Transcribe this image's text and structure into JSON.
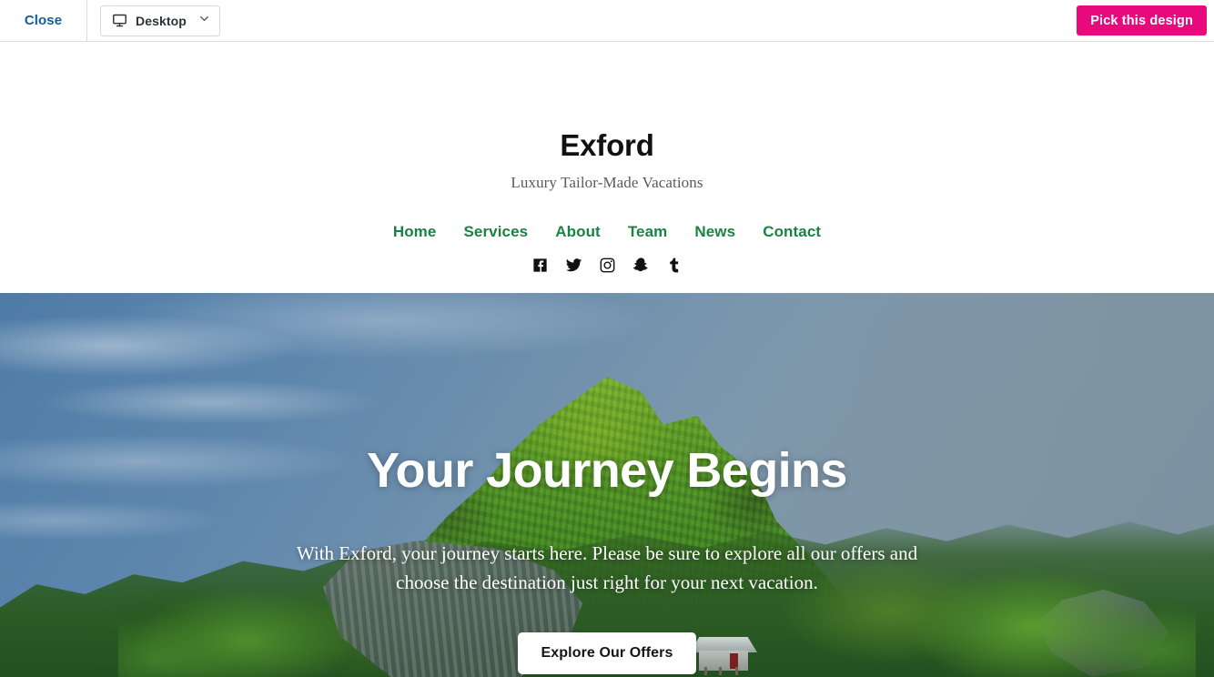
{
  "toolbar": {
    "close_label": "Close",
    "device_label": "Desktop",
    "device_icon": "monitor-icon",
    "chevron_icon": "chevron-down-icon",
    "pick_design_label": "Pick this design"
  },
  "colors": {
    "accent_pink": "#e80a7d",
    "brand_green": "#1a8242",
    "close_link_blue": "#135e96",
    "toolbar_border": "#dcdcde",
    "hero_text": "#ffffff",
    "site_title": "#111111",
    "tagline_gray": "#5a5a5a"
  },
  "site": {
    "title": "Exford",
    "tagline": "Luxury Tailor-Made Vacations",
    "nav": [
      {
        "label": "Home"
      },
      {
        "label": "Services"
      },
      {
        "label": "About"
      },
      {
        "label": "Team"
      },
      {
        "label": "News"
      },
      {
        "label": "Contact"
      }
    ],
    "social": [
      {
        "name": "facebook-icon"
      },
      {
        "name": "twitter-icon"
      },
      {
        "name": "instagram-icon"
      },
      {
        "name": "snapchat-icon"
      },
      {
        "name": "tumblr-icon"
      }
    ]
  },
  "hero": {
    "heading": "Your Journey Begins",
    "body": "With Exford, your journey starts here. Please be sure to explore all our offers and choose the destination just right for your next vacation.",
    "cta_label": "Explore Our Offers"
  }
}
